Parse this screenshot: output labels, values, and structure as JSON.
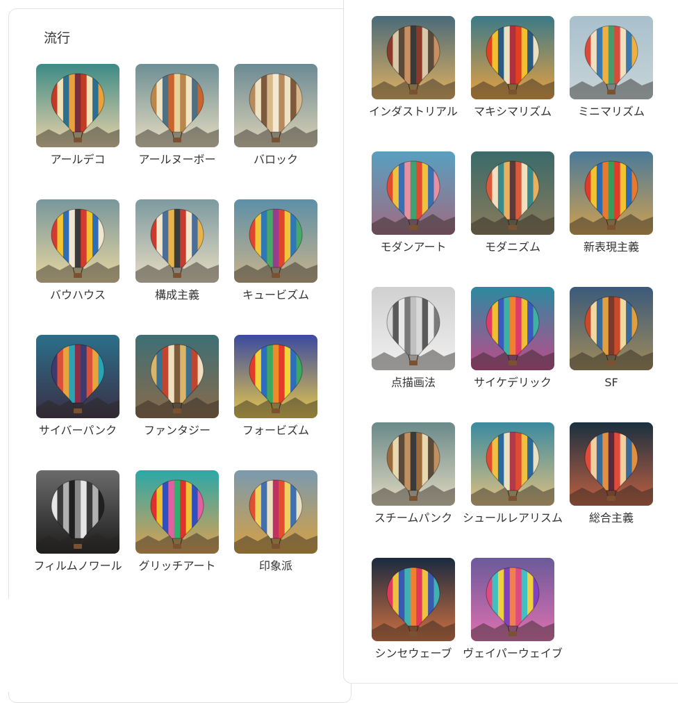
{
  "section_title": "流行",
  "left_styles": [
    {
      "label": "アールデコ",
      "bg_top": "#3d8a86",
      "bg_bottom": "#e9d3a8",
      "stripes": [
        "#c23b22",
        "#f2e2b8",
        "#2d6f8e",
        "#e9a13b",
        "#7a2e3a"
      ]
    },
    {
      "label": "アールヌーボー",
      "bg_top": "#6d8f95",
      "bg_bottom": "#e6dcc0",
      "stripes": [
        "#b9874b",
        "#f1e4c3",
        "#4f6f83",
        "#c8642c",
        "#e8d19a"
      ]
    },
    {
      "label": "バロック",
      "bg_top": "#6b8a94",
      "bg_bottom": "#dcd2b6",
      "stripes": [
        "#b58a5c",
        "#efe2c4",
        "#7d5a3c",
        "#d8b98c",
        "#f3e9d2"
      ]
    },
    {
      "label": "バウハウス",
      "bg_top": "#78979c",
      "bg_bottom": "#e8d6a0",
      "stripes": [
        "#d43a2f",
        "#f2c230",
        "#2f6db5",
        "#f1e7d0",
        "#3a3a3a"
      ]
    },
    {
      "label": "構成主義",
      "bg_top": "#7c9aa0",
      "bg_bottom": "#e8dcc2",
      "stripes": [
        "#c73c2e",
        "#f3e6cb",
        "#4b6f98",
        "#e8b34a",
        "#3b3b3b"
      ]
    },
    {
      "label": "キュービズム",
      "bg_top": "#5d8fa8",
      "bg_bottom": "#c9b38a",
      "stripes": [
        "#e0452b",
        "#f2c438",
        "#2e78b8",
        "#48a86a",
        "#9a3d8f"
      ]
    },
    {
      "label": "サイバーパンク",
      "bg_top": "#2b6f8a",
      "bg_bottom": "#3a2f45",
      "stripes": [
        "#3c3a6e",
        "#d8503a",
        "#e7a33d",
        "#2aa3b3",
        "#8a2e4a"
      ]
    },
    {
      "label": "ファンタジー",
      "bg_top": "#3d6f75",
      "bg_bottom": "#8a6a4a",
      "stripes": [
        "#d9b56a",
        "#3e6f8c",
        "#c2452e",
        "#efe0c0",
        "#7d5a3a"
      ]
    },
    {
      "label": "フォービズム",
      "bg_top": "#3a4aa0",
      "bg_bottom": "#e8c84a",
      "stripes": [
        "#e33a2a",
        "#f2d23a",
        "#2e6cc0",
        "#3aa860",
        "#f08a2a"
      ]
    },
    {
      "label": "フィルムノワール",
      "bg_top": "#6b6b6b",
      "bg_bottom": "#1c1c1c",
      "stripes": [
        "#e6e6e6",
        "#3a3a3a",
        "#b0b0b0",
        "#202020",
        "#8a8a8a"
      ]
    },
    {
      "label": "グリッチアート",
      "bg_top": "#2aa8a8",
      "bg_bottom": "#e0a050",
      "stripes": [
        "#e0302a",
        "#f0c030",
        "#3050c0",
        "#e060a0",
        "#30b070"
      ]
    },
    {
      "label": "印象派",
      "bg_top": "#7a9ab0",
      "bg_bottom": "#d8a040",
      "stripes": [
        "#e05030",
        "#f0d060",
        "#4070b0",
        "#e8e0c0",
        "#c03060"
      ]
    }
  ],
  "right_styles": [
    {
      "label": "インダストリアル",
      "bg_top": "#4a6a7a",
      "bg_bottom": "#e0b060",
      "stripes": [
        "#8a3a2a",
        "#d8c8a8",
        "#5a4a3a",
        "#c89060",
        "#3a3a3a"
      ]
    },
    {
      "label": "マキシマリズム",
      "bg_top": "#3a7a88",
      "bg_bottom": "#e8a040",
      "stripes": [
        "#e04020",
        "#f0c030",
        "#2a5a80",
        "#e8e0c0",
        "#b03040"
      ]
    },
    {
      "label": "ミニマリズム",
      "bg_top": "#a8c0cc",
      "bg_bottom": "#c8d4d8",
      "stripes": [
        "#d84a3a",
        "#f0e0c0",
        "#3a7ab0",
        "#f0b040",
        "#4a9a6a"
      ]
    },
    {
      "label": "モダンアート",
      "bg_top": "#58a0c0",
      "bg_bottom": "#a06a80",
      "stripes": [
        "#e04a30",
        "#f0c040",
        "#3a70b0",
        "#e890a0",
        "#40a070"
      ]
    },
    {
      "label": "モダニズム",
      "bg_top": "#3a6a6a",
      "bg_bottom": "#8a7a5a",
      "stripes": [
        "#d85a3a",
        "#f0e0c0",
        "#3a8a8a",
        "#e8b060",
        "#5a3a3a"
      ]
    },
    {
      "label": "新表現主義",
      "bg_top": "#4a7a9a",
      "bg_bottom": "#d0a050",
      "stripes": [
        "#e03a2a",
        "#f2c430",
        "#2e6ab0",
        "#e87a30",
        "#3a9a5a"
      ]
    },
    {
      "label": "点描画法",
      "bg_top": "#d0d0d0",
      "bg_bottom": "#f0f0f0",
      "stripes": [
        "#d8d8d8",
        "#5a5a5a",
        "#e8e8e8",
        "#7a7a7a",
        "#c0c0c0"
      ]
    },
    {
      "label": "サイケデリック",
      "bg_top": "#2a8aa0",
      "bg_bottom": "#c04a8a",
      "stripes": [
        "#e03a6a",
        "#f0c030",
        "#3a5ac0",
        "#40b0a0",
        "#f08030"
      ]
    },
    {
      "label": "SF",
      "bg_top": "#3a5a7a",
      "bg_bottom": "#a08a5a",
      "stripes": [
        "#c84a2a",
        "#f0d8a0",
        "#3a6a9a",
        "#e0a040",
        "#7a3a2a"
      ]
    },
    {
      "label": "スチームパンク",
      "bg_top": "#6a8a8a",
      "bg_bottom": "#e0d8c0",
      "stripes": [
        "#9a6a3a",
        "#e8d8b0",
        "#5a4a3a",
        "#c09060",
        "#3a3a3a"
      ]
    },
    {
      "label": "シュールレアリスム",
      "bg_top": "#3a8aa0",
      "bg_bottom": "#e0c080",
      "stripes": [
        "#e04a30",
        "#f0c040",
        "#2a6a9a",
        "#e8e0c0",
        "#b03a4a"
      ]
    },
    {
      "label": "総合主義",
      "bg_top": "#1a3040",
      "bg_bottom": "#c06040",
      "stripes": [
        "#e04a3a",
        "#f0d0a0",
        "#3a6a9a",
        "#e09040",
        "#5a2a3a"
      ]
    },
    {
      "label": "シンセウェーブ",
      "bg_top": "#1a2a40",
      "bg_bottom": "#d07040",
      "stripes": [
        "#e03a5a",
        "#f0c040",
        "#3a5ab0",
        "#40b0b0",
        "#f08030"
      ]
    },
    {
      "label": "ヴェイパーウェイブ",
      "bg_top": "#6a5a9a",
      "bg_bottom": "#e070b0",
      "stripes": [
        "#e04a80",
        "#40c0c0",
        "#f0d040",
        "#8040c0",
        "#f08050"
      ]
    }
  ]
}
